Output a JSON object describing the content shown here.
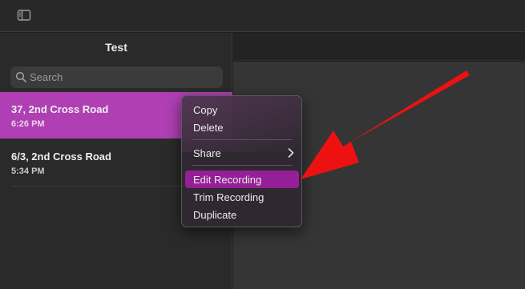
{
  "sidebar": {
    "title": "Test",
    "search_placeholder": "Search",
    "recordings": [
      {
        "title": "37, 2nd Cross Road",
        "time": "6:26 PM",
        "selected": true
      },
      {
        "title": "6/3, 2nd Cross Road",
        "time": "5:34 PM",
        "selected": false
      }
    ]
  },
  "context_menu": {
    "items": [
      {
        "label": "Copy"
      },
      {
        "label": "Delete"
      },
      {
        "label": "Share",
        "has_submenu": true
      },
      {
        "label": "Edit Recording",
        "highlighted": true
      },
      {
        "label": "Trim Recording"
      },
      {
        "label": "Duplicate"
      }
    ]
  },
  "colors": {
    "selection": "#b03fb3",
    "menu_highlight": "#951f96",
    "arrow": "#ee1111"
  },
  "icons": [
    "sidebar-toggle-icon",
    "search-icon",
    "chevron-right-icon",
    "red-arrow-annotation"
  ]
}
